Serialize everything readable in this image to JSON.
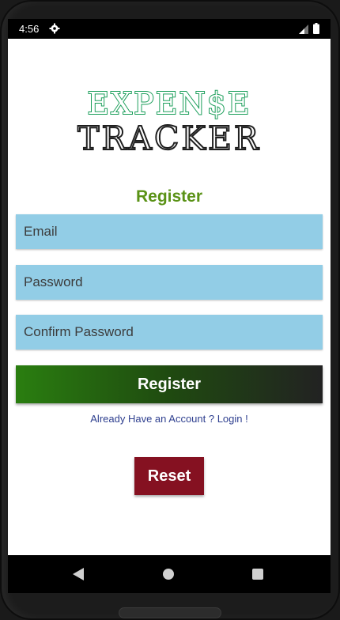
{
  "status_bar": {
    "time": "4:56",
    "gear_icon": "gear-icon",
    "signal_icon": "signal-icon",
    "battery_icon": "battery-icon"
  },
  "logo": {
    "line1": "EXPEN$E",
    "line2": "TRACKER",
    "line1_color": "#1b9e5a",
    "line2_color": "#1f1f1f"
  },
  "form": {
    "title": "Register",
    "email_placeholder": "Email",
    "password_placeholder": "Password",
    "confirm_placeholder": "Confirm Password",
    "register_label": "Register",
    "login_link": "Already Have an Account ? Login !",
    "reset_label": "Reset"
  },
  "colors": {
    "title": "#5a9216",
    "field_bg": "#92cde6",
    "reset_bg": "#851121",
    "link": "#2e3f8f"
  },
  "nav": {
    "back_icon": "back-icon",
    "home_icon": "home-icon",
    "recents_icon": "recents-icon"
  }
}
